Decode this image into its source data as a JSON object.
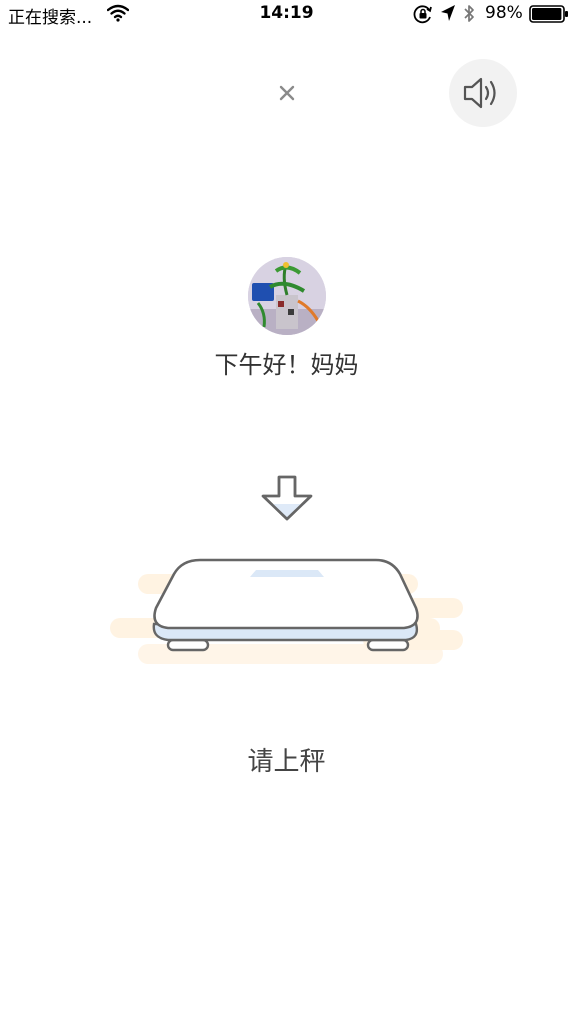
{
  "status_bar": {
    "carrier": "正在搜索...",
    "time": "14:19",
    "battery_percent": "98%",
    "battery_level": 0.98
  },
  "header": {
    "close_glyph": "×",
    "close_icon": "close-icon",
    "sound_icon": "speaker-volume-icon"
  },
  "profile": {
    "greeting": "下午好！妈妈"
  },
  "weigh": {
    "arrow_icon": "arrow-down-icon",
    "scale_icon": "bathroom-scale-icon",
    "instruction": "请上秤"
  },
  "colors": {
    "background": "#ffffff",
    "scale_outline": "#666666",
    "scale_accent": "#dbe8f7",
    "scale_glow": "#fff5e6",
    "sound_button_bg": "#f2f2f2"
  }
}
